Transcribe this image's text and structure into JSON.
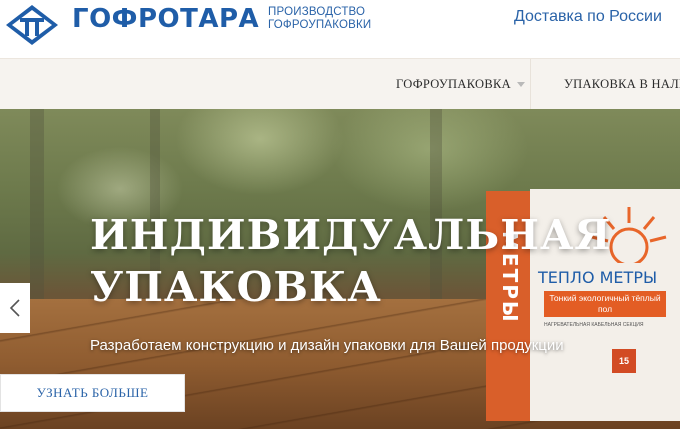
{
  "header": {
    "brand": "ГОФРОТАРА",
    "tagline": "ПРОИЗВОДСТВО ГОФРОУПАКОВКИ",
    "delivery_link": "Доставка по России"
  },
  "nav": {
    "items": [
      {
        "label": "ГОФРОУПАКОВКА",
        "has_dropdown": true
      },
      {
        "label": "УПАКОВКА В НАЛИ"
      }
    ]
  },
  "hero": {
    "title_line1": "ИНДИВИДУАЛЬНАЯ",
    "title_line2": "УПАКОВКА",
    "subtitle": "Разработаем конструкцию и дизайн упаковки для Вашей продукции",
    "cta_label": "УЗНАТЬ БОЛЬШЕ",
    "prev_icon": "chevron-left-icon"
  },
  "product": {
    "side_text": "МЕТРЫ",
    "brand": "ТЕПЛО МЕТРЫ",
    "banner": "Тонкий экологичный тёплый пол",
    "fine_print": "НАГРЕВАТЕЛЬНАЯ КАБЕЛЬНАЯ СЕКЦИЯ",
    "badge": "15"
  },
  "colors": {
    "brand_blue": "#1f5da8",
    "nav_bg": "#f6f3ef",
    "box_orange": "#d95f2a"
  }
}
